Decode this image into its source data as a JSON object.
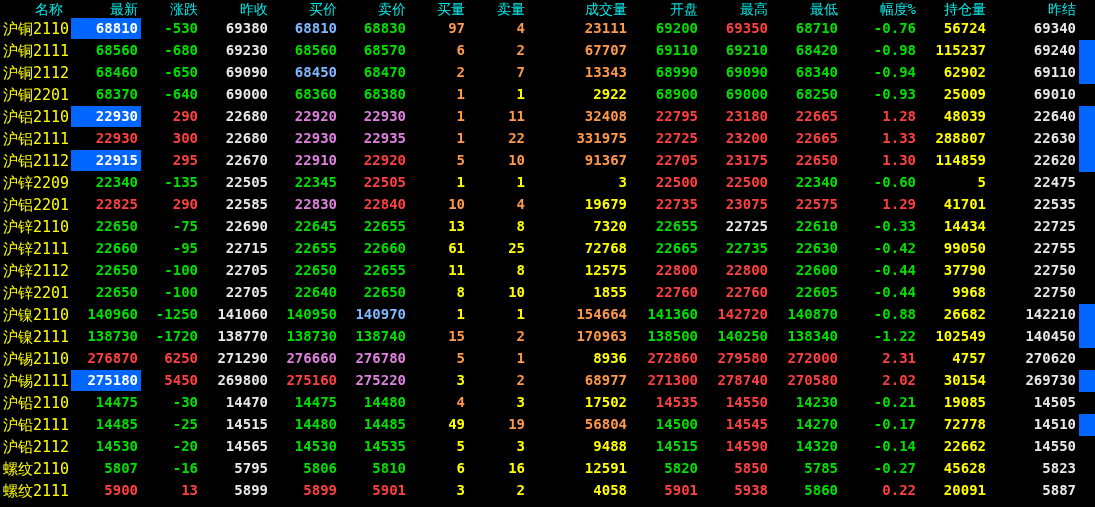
{
  "columns": [
    "名称",
    "最新",
    "涨跌",
    "昨收",
    "买价",
    "卖价",
    "买量",
    "卖量",
    "成交量",
    "开盘",
    "最高",
    "最低",
    "幅度%",
    "持仓量",
    "昨结"
  ],
  "rows": [
    {
      "name": "沪铜2110",
      "highlight": true,
      "marked": false,
      "cells": [
        {
          "text": "68810",
          "color": "#ffffff"
        },
        {
          "text": "-530",
          "color": "#00e000"
        },
        {
          "text": "69380",
          "color": "#e8e8e8"
        },
        {
          "text": "68810",
          "color": "#80b8ff"
        },
        {
          "text": "68830",
          "color": "#00e000"
        },
        {
          "text": "97",
          "color": "#ff9848"
        },
        {
          "text": "4",
          "color": "#ff9848"
        },
        {
          "text": "23111",
          "color": "#ff9848"
        },
        {
          "text": "69200",
          "color": "#00e000"
        },
        {
          "text": "69350",
          "color": "#ff4040"
        },
        {
          "text": "68710",
          "color": "#00e000"
        },
        {
          "text": "-0.76",
          "color": "#00e000"
        },
        {
          "text": "56724",
          "color": "#ffff00"
        },
        {
          "text": "69340",
          "color": "#e8e8e8"
        }
      ]
    },
    {
      "name": "沪铜2111",
      "highlight": false,
      "marked": true,
      "cells": [
        {
          "text": "68560",
          "color": "#00e000"
        },
        {
          "text": "-680",
          "color": "#00e000"
        },
        {
          "text": "69230",
          "color": "#e8e8e8"
        },
        {
          "text": "68560",
          "color": "#00e000"
        },
        {
          "text": "68570",
          "color": "#00e000"
        },
        {
          "text": "6",
          "color": "#ff9848"
        },
        {
          "text": "2",
          "color": "#ff9848"
        },
        {
          "text": "67707",
          "color": "#ff9848"
        },
        {
          "text": "69110",
          "color": "#00e000"
        },
        {
          "text": "69210",
          "color": "#00e000"
        },
        {
          "text": "68420",
          "color": "#00e000"
        },
        {
          "text": "-0.98",
          "color": "#00e000"
        },
        {
          "text": "115237",
          "color": "#ffff00"
        },
        {
          "text": "69240",
          "color": "#e8e8e8"
        }
      ]
    },
    {
      "name": "沪铜2112",
      "highlight": false,
      "marked": true,
      "cells": [
        {
          "text": "68460",
          "color": "#00e000"
        },
        {
          "text": "-650",
          "color": "#00e000"
        },
        {
          "text": "69090",
          "color": "#e8e8e8"
        },
        {
          "text": "68450",
          "color": "#80b8ff"
        },
        {
          "text": "68470",
          "color": "#00e000"
        },
        {
          "text": "2",
          "color": "#ff9848"
        },
        {
          "text": "7",
          "color": "#ff9848"
        },
        {
          "text": "13343",
          "color": "#ff9848"
        },
        {
          "text": "68990",
          "color": "#00e000"
        },
        {
          "text": "69090",
          "color": "#00e000"
        },
        {
          "text": "68340",
          "color": "#00e000"
        },
        {
          "text": "-0.94",
          "color": "#00e000"
        },
        {
          "text": "62902",
          "color": "#ffff00"
        },
        {
          "text": "69110",
          "color": "#e8e8e8"
        }
      ]
    },
    {
      "name": "沪铜2201",
      "highlight": false,
      "marked": false,
      "cells": [
        {
          "text": "68370",
          "color": "#00e000"
        },
        {
          "text": "-640",
          "color": "#00e000"
        },
        {
          "text": "69000",
          "color": "#e8e8e8"
        },
        {
          "text": "68360",
          "color": "#00e000"
        },
        {
          "text": "68380",
          "color": "#00e000"
        },
        {
          "text": "1",
          "color": "#ff9848"
        },
        {
          "text": "1",
          "color": "#ffff00"
        },
        {
          "text": "2922",
          "color": "#ffff00"
        },
        {
          "text": "68900",
          "color": "#00e000"
        },
        {
          "text": "69000",
          "color": "#00e000"
        },
        {
          "text": "68250",
          "color": "#00e000"
        },
        {
          "text": "-0.93",
          "color": "#00e000"
        },
        {
          "text": "25009",
          "color": "#ffff00"
        },
        {
          "text": "69010",
          "color": "#e8e8e8"
        }
      ]
    },
    {
      "name": "沪铝2110",
      "highlight": true,
      "marked": true,
      "cells": [
        {
          "text": "22930",
          "color": "#ffffff"
        },
        {
          "text": "290",
          "color": "#ff4040"
        },
        {
          "text": "22680",
          "color": "#e8e8e8"
        },
        {
          "text": "22920",
          "color": "#e080e0"
        },
        {
          "text": "22930",
          "color": "#e080e0"
        },
        {
          "text": "1",
          "color": "#ff9848"
        },
        {
          "text": "11",
          "color": "#ff9848"
        },
        {
          "text": "32408",
          "color": "#ff9848"
        },
        {
          "text": "22795",
          "color": "#ff4040"
        },
        {
          "text": "23180",
          "color": "#ff4040"
        },
        {
          "text": "22665",
          "color": "#ff4040"
        },
        {
          "text": "1.28",
          "color": "#ff4040"
        },
        {
          "text": "48039",
          "color": "#ffff00"
        },
        {
          "text": "22640",
          "color": "#e8e8e8"
        }
      ]
    },
    {
      "name": "沪铝2111",
      "highlight": false,
      "marked": true,
      "cells": [
        {
          "text": "22930",
          "color": "#ff4040"
        },
        {
          "text": "300",
          "color": "#ff4040"
        },
        {
          "text": "22680",
          "color": "#e8e8e8"
        },
        {
          "text": "22930",
          "color": "#e080e0"
        },
        {
          "text": "22935",
          "color": "#e080e0"
        },
        {
          "text": "1",
          "color": "#ff9848"
        },
        {
          "text": "22",
          "color": "#ff9848"
        },
        {
          "text": "331975",
          "color": "#ff9848"
        },
        {
          "text": "22725",
          "color": "#ff4040"
        },
        {
          "text": "23200",
          "color": "#ff4040"
        },
        {
          "text": "22665",
          "color": "#ff4040"
        },
        {
          "text": "1.33",
          "color": "#ff4040"
        },
        {
          "text": "288807",
          "color": "#ffff00"
        },
        {
          "text": "22630",
          "color": "#e8e8e8"
        }
      ]
    },
    {
      "name": "沪铝2112",
      "highlight": true,
      "marked": true,
      "cells": [
        {
          "text": "22915",
          "color": "#ffffff"
        },
        {
          "text": "295",
          "color": "#ff4040"
        },
        {
          "text": "22670",
          "color": "#e8e8e8"
        },
        {
          "text": "22910",
          "color": "#e080e0"
        },
        {
          "text": "22920",
          "color": "#ff4040"
        },
        {
          "text": "5",
          "color": "#ff9848"
        },
        {
          "text": "10",
          "color": "#ff9848"
        },
        {
          "text": "91367",
          "color": "#ff9848"
        },
        {
          "text": "22705",
          "color": "#ff4040"
        },
        {
          "text": "23175",
          "color": "#ff4040"
        },
        {
          "text": "22650",
          "color": "#ff4040"
        },
        {
          "text": "1.30",
          "color": "#ff4040"
        },
        {
          "text": "114859",
          "color": "#ffff00"
        },
        {
          "text": "22620",
          "color": "#e8e8e8"
        }
      ]
    },
    {
      "name": "沪锌2209",
      "highlight": false,
      "marked": false,
      "cells": [
        {
          "text": "22340",
          "color": "#00e000"
        },
        {
          "text": "-135",
          "color": "#00e000"
        },
        {
          "text": "22505",
          "color": "#e8e8e8"
        },
        {
          "text": "22345",
          "color": "#00e000"
        },
        {
          "text": "22505",
          "color": "#ff4040"
        },
        {
          "text": "1",
          "color": "#ffff00"
        },
        {
          "text": "1",
          "color": "#ffff00"
        },
        {
          "text": "3",
          "color": "#ffff00"
        },
        {
          "text": "22500",
          "color": "#ff4040"
        },
        {
          "text": "22500",
          "color": "#ff4040"
        },
        {
          "text": "22340",
          "color": "#00e000"
        },
        {
          "text": "-0.60",
          "color": "#00e000"
        },
        {
          "text": "5",
          "color": "#ffff00"
        },
        {
          "text": "22475",
          "color": "#e8e8e8"
        }
      ]
    },
    {
      "name": "沪铝2201",
      "highlight": false,
      "marked": false,
      "cells": [
        {
          "text": "22825",
          "color": "#ff4040"
        },
        {
          "text": "290",
          "color": "#ff4040"
        },
        {
          "text": "22585",
          "color": "#e8e8e8"
        },
        {
          "text": "22830",
          "color": "#e080e0"
        },
        {
          "text": "22840",
          "color": "#ff4040"
        },
        {
          "text": "10",
          "color": "#ff9848"
        },
        {
          "text": "4",
          "color": "#ff9848"
        },
        {
          "text": "19679",
          "color": "#ffff00"
        },
        {
          "text": "22735",
          "color": "#ff4040"
        },
        {
          "text": "23075",
          "color": "#ff4040"
        },
        {
          "text": "22575",
          "color": "#ff4040"
        },
        {
          "text": "1.29",
          "color": "#ff4040"
        },
        {
          "text": "41701",
          "color": "#ffff00"
        },
        {
          "text": "22535",
          "color": "#e8e8e8"
        }
      ]
    },
    {
      "name": "沪锌2110",
      "highlight": false,
      "marked": false,
      "cells": [
        {
          "text": "22650",
          "color": "#00e000"
        },
        {
          "text": "-75",
          "color": "#00e000"
        },
        {
          "text": "22690",
          "color": "#e8e8e8"
        },
        {
          "text": "22645",
          "color": "#00e000"
        },
        {
          "text": "22655",
          "color": "#00e000"
        },
        {
          "text": "13",
          "color": "#ffff00"
        },
        {
          "text": "8",
          "color": "#ffff00"
        },
        {
          "text": "7320",
          "color": "#ffff00"
        },
        {
          "text": "22655",
          "color": "#00e000"
        },
        {
          "text": "22725",
          "color": "#e8e8e8"
        },
        {
          "text": "22610",
          "color": "#00e000"
        },
        {
          "text": "-0.33",
          "color": "#00e000"
        },
        {
          "text": "14434",
          "color": "#ffff00"
        },
        {
          "text": "22725",
          "color": "#e8e8e8"
        }
      ]
    },
    {
      "name": "沪锌2111",
      "highlight": false,
      "marked": false,
      "cells": [
        {
          "text": "22660",
          "color": "#00e000"
        },
        {
          "text": "-95",
          "color": "#00e000"
        },
        {
          "text": "22715",
          "color": "#e8e8e8"
        },
        {
          "text": "22655",
          "color": "#00e000"
        },
        {
          "text": "22660",
          "color": "#00e000"
        },
        {
          "text": "61",
          "color": "#ffff00"
        },
        {
          "text": "25",
          "color": "#ffff00"
        },
        {
          "text": "72768",
          "color": "#ffff00"
        },
        {
          "text": "22665",
          "color": "#00e000"
        },
        {
          "text": "22735",
          "color": "#00e000"
        },
        {
          "text": "22630",
          "color": "#00e000"
        },
        {
          "text": "-0.42",
          "color": "#00e000"
        },
        {
          "text": "99050",
          "color": "#ffff00"
        },
        {
          "text": "22755",
          "color": "#e8e8e8"
        }
      ]
    },
    {
      "name": "沪锌2112",
      "highlight": false,
      "marked": false,
      "cells": [
        {
          "text": "22650",
          "color": "#00e000"
        },
        {
          "text": "-100",
          "color": "#00e000"
        },
        {
          "text": "22705",
          "color": "#e8e8e8"
        },
        {
          "text": "22650",
          "color": "#00e000"
        },
        {
          "text": "22655",
          "color": "#00e000"
        },
        {
          "text": "11",
          "color": "#ffff00"
        },
        {
          "text": "8",
          "color": "#ffff00"
        },
        {
          "text": "12575",
          "color": "#ffff00"
        },
        {
          "text": "22800",
          "color": "#ff4040"
        },
        {
          "text": "22800",
          "color": "#ff4040"
        },
        {
          "text": "22600",
          "color": "#00e000"
        },
        {
          "text": "-0.44",
          "color": "#00e000"
        },
        {
          "text": "37790",
          "color": "#ffff00"
        },
        {
          "text": "22750",
          "color": "#e8e8e8"
        }
      ]
    },
    {
      "name": "沪锌2201",
      "highlight": false,
      "marked": false,
      "cells": [
        {
          "text": "22650",
          "color": "#00e000"
        },
        {
          "text": "-100",
          "color": "#00e000"
        },
        {
          "text": "22705",
          "color": "#e8e8e8"
        },
        {
          "text": "22640",
          "color": "#00e000"
        },
        {
          "text": "22650",
          "color": "#00e000"
        },
        {
          "text": "8",
          "color": "#ffff00"
        },
        {
          "text": "10",
          "color": "#ffff00"
        },
        {
          "text": "1855",
          "color": "#ffff00"
        },
        {
          "text": "22760",
          "color": "#ff4040"
        },
        {
          "text": "22760",
          "color": "#ff4040"
        },
        {
          "text": "22605",
          "color": "#00e000"
        },
        {
          "text": "-0.44",
          "color": "#00e000"
        },
        {
          "text": "9968",
          "color": "#ffff00"
        },
        {
          "text": "22750",
          "color": "#e8e8e8"
        }
      ]
    },
    {
      "name": "沪镍2110",
      "highlight": false,
      "marked": true,
      "cells": [
        {
          "text": "140960",
          "color": "#00e000"
        },
        {
          "text": "-1250",
          "color": "#00e000"
        },
        {
          "text": "141060",
          "color": "#e8e8e8"
        },
        {
          "text": "140950",
          "color": "#00e000"
        },
        {
          "text": "140970",
          "color": "#80b8ff"
        },
        {
          "text": "1",
          "color": "#ffff00"
        },
        {
          "text": "1",
          "color": "#ffff00"
        },
        {
          "text": "154664",
          "color": "#ff9848"
        },
        {
          "text": "141360",
          "color": "#00e000"
        },
        {
          "text": "142720",
          "color": "#ff4040"
        },
        {
          "text": "140870",
          "color": "#00e000"
        },
        {
          "text": "-0.88",
          "color": "#00e000"
        },
        {
          "text": "26682",
          "color": "#ffff00"
        },
        {
          "text": "142210",
          "color": "#e8e8e8"
        }
      ]
    },
    {
      "name": "沪镍2111",
      "highlight": false,
      "marked": true,
      "cells": [
        {
          "text": "138730",
          "color": "#00e000"
        },
        {
          "text": "-1720",
          "color": "#00e000"
        },
        {
          "text": "138770",
          "color": "#e8e8e8"
        },
        {
          "text": "138730",
          "color": "#00e000"
        },
        {
          "text": "138740",
          "color": "#00e000"
        },
        {
          "text": "15",
          "color": "#ff9848"
        },
        {
          "text": "2",
          "color": "#ff9848"
        },
        {
          "text": "170963",
          "color": "#ff9848"
        },
        {
          "text": "138500",
          "color": "#00e000"
        },
        {
          "text": "140250",
          "color": "#00e000"
        },
        {
          "text": "138340",
          "color": "#00e000"
        },
        {
          "text": "-1.22",
          "color": "#00e000"
        },
        {
          "text": "102549",
          "color": "#ffff00"
        },
        {
          "text": "140450",
          "color": "#e8e8e8"
        }
      ]
    },
    {
      "name": "沪锡2110",
      "highlight": false,
      "marked": false,
      "cells": [
        {
          "text": "276870",
          "color": "#ff4040"
        },
        {
          "text": "6250",
          "color": "#ff4040"
        },
        {
          "text": "271290",
          "color": "#e8e8e8"
        },
        {
          "text": "276660",
          "color": "#e080e0"
        },
        {
          "text": "276780",
          "color": "#e080e0"
        },
        {
          "text": "5",
          "color": "#ff9848"
        },
        {
          "text": "1",
          "color": "#ff9848"
        },
        {
          "text": "8936",
          "color": "#ffff00"
        },
        {
          "text": "272860",
          "color": "#ff4040"
        },
        {
          "text": "279580",
          "color": "#ff4040"
        },
        {
          "text": "272000",
          "color": "#ff4040"
        },
        {
          "text": "2.31",
          "color": "#ff4040"
        },
        {
          "text": "4757",
          "color": "#ffff00"
        },
        {
          "text": "270620",
          "color": "#e8e8e8"
        }
      ]
    },
    {
      "name": "沪锡2111",
      "highlight": true,
      "marked": true,
      "cells": [
        {
          "text": "275180",
          "color": "#ffffff"
        },
        {
          "text": "5450",
          "color": "#ff4040"
        },
        {
          "text": "269800",
          "color": "#e8e8e8"
        },
        {
          "text": "275160",
          "color": "#ff4040"
        },
        {
          "text": "275220",
          "color": "#e080e0"
        },
        {
          "text": "3",
          "color": "#ffff00"
        },
        {
          "text": "2",
          "color": "#ff9848"
        },
        {
          "text": "68977",
          "color": "#ff9848"
        },
        {
          "text": "271300",
          "color": "#ff4040"
        },
        {
          "text": "278740",
          "color": "#ff4040"
        },
        {
          "text": "270580",
          "color": "#ff4040"
        },
        {
          "text": "2.02",
          "color": "#ff4040"
        },
        {
          "text": "30154",
          "color": "#ffff00"
        },
        {
          "text": "269730",
          "color": "#e8e8e8"
        }
      ]
    },
    {
      "name": "沪铅2110",
      "highlight": false,
      "marked": false,
      "cells": [
        {
          "text": "14475",
          "color": "#00e000"
        },
        {
          "text": "-30",
          "color": "#00e000"
        },
        {
          "text": "14470",
          "color": "#e8e8e8"
        },
        {
          "text": "14475",
          "color": "#00e000"
        },
        {
          "text": "14480",
          "color": "#00e000"
        },
        {
          "text": "4",
          "color": "#ff9848"
        },
        {
          "text": "3",
          "color": "#ffff00"
        },
        {
          "text": "17502",
          "color": "#ffff00"
        },
        {
          "text": "14535",
          "color": "#ff4040"
        },
        {
          "text": "14550",
          "color": "#ff4040"
        },
        {
          "text": "14230",
          "color": "#00e000"
        },
        {
          "text": "-0.21",
          "color": "#00e000"
        },
        {
          "text": "19085",
          "color": "#ffff00"
        },
        {
          "text": "14505",
          "color": "#e8e8e8"
        }
      ]
    },
    {
      "name": "沪铅2111",
      "highlight": false,
      "marked": true,
      "cells": [
        {
          "text": "14485",
          "color": "#00e000"
        },
        {
          "text": "-25",
          "color": "#00e000"
        },
        {
          "text": "14515",
          "color": "#e8e8e8"
        },
        {
          "text": "14480",
          "color": "#00e000"
        },
        {
          "text": "14485",
          "color": "#00e000"
        },
        {
          "text": "49",
          "color": "#ffff00"
        },
        {
          "text": "19",
          "color": "#ff9848"
        },
        {
          "text": "56804",
          "color": "#ff9848"
        },
        {
          "text": "14500",
          "color": "#00e000"
        },
        {
          "text": "14545",
          "color": "#ff4040"
        },
        {
          "text": "14270",
          "color": "#00e000"
        },
        {
          "text": "-0.17",
          "color": "#00e000"
        },
        {
          "text": "72778",
          "color": "#ffff00"
        },
        {
          "text": "14510",
          "color": "#e8e8e8"
        }
      ]
    },
    {
      "name": "沪铅2112",
      "highlight": false,
      "marked": false,
      "cells": [
        {
          "text": "14530",
          "color": "#00e000"
        },
        {
          "text": "-20",
          "color": "#00e000"
        },
        {
          "text": "14565",
          "color": "#e8e8e8"
        },
        {
          "text": "14530",
          "color": "#00e000"
        },
        {
          "text": "14535",
          "color": "#00e000"
        },
        {
          "text": "5",
          "color": "#ffff00"
        },
        {
          "text": "3",
          "color": "#ffff00"
        },
        {
          "text": "9488",
          "color": "#ffff00"
        },
        {
          "text": "14515",
          "color": "#00e000"
        },
        {
          "text": "14590",
          "color": "#ff4040"
        },
        {
          "text": "14320",
          "color": "#00e000"
        },
        {
          "text": "-0.14",
          "color": "#00e000"
        },
        {
          "text": "22662",
          "color": "#ffff00"
        },
        {
          "text": "14550",
          "color": "#e8e8e8"
        }
      ]
    },
    {
      "name": "螺纹2110",
      "highlight": false,
      "marked": false,
      "cells": [
        {
          "text": "5807",
          "color": "#00e000"
        },
        {
          "text": "-16",
          "color": "#00e000"
        },
        {
          "text": "5795",
          "color": "#e8e8e8"
        },
        {
          "text": "5806",
          "color": "#00e000"
        },
        {
          "text": "5810",
          "color": "#00e000"
        },
        {
          "text": "6",
          "color": "#ffff00"
        },
        {
          "text": "16",
          "color": "#ffff00"
        },
        {
          "text": "12591",
          "color": "#ffff00"
        },
        {
          "text": "5820",
          "color": "#00e000"
        },
        {
          "text": "5850",
          "color": "#ff4040"
        },
        {
          "text": "5785",
          "color": "#00e000"
        },
        {
          "text": "-0.27",
          "color": "#00e000"
        },
        {
          "text": "45628",
          "color": "#ffff00"
        },
        {
          "text": "5823",
          "color": "#e8e8e8"
        }
      ]
    },
    {
      "name": "螺纹2111",
      "highlight": false,
      "marked": false,
      "cells": [
        {
          "text": "5900",
          "color": "#ff4040"
        },
        {
          "text": "13",
          "color": "#ff4040"
        },
        {
          "text": "5899",
          "color": "#e8e8e8"
        },
        {
          "text": "5899",
          "color": "#ff4040"
        },
        {
          "text": "5901",
          "color": "#ff4040"
        },
        {
          "text": "3",
          "color": "#ffff00"
        },
        {
          "text": "2",
          "color": "#ffff00"
        },
        {
          "text": "4058",
          "color": "#ffff00"
        },
        {
          "text": "5901",
          "color": "#ff4040"
        },
        {
          "text": "5938",
          "color": "#ff4040"
        },
        {
          "text": "5860",
          "color": "#00e000"
        },
        {
          "text": "0.22",
          "color": "#ff4040"
        },
        {
          "text": "20091",
          "color": "#ffff00"
        },
        {
          "text": "5887",
          "color": "#e8e8e8"
        }
      ]
    }
  ]
}
